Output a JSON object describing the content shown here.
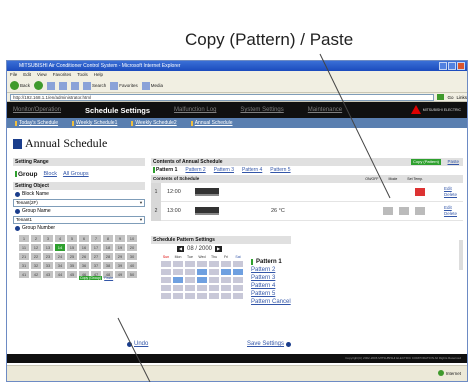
{
  "callout": {
    "top_label": "Copy (Pattern) / Paste"
  },
  "browser": {
    "title": "MITSUBISHI Air Conditioner Control System - Microsoft Internet Explorer",
    "menu": [
      "File",
      "Edit",
      "View",
      "Favorites",
      "Tools",
      "Help"
    ],
    "toolbar": {
      "back": "Back",
      "search": "Search",
      "favorites": "Favorites",
      "media": "Media"
    },
    "address": "http://192.168.1.1/en/administrator.html",
    "go_label": "Go",
    "links_label": "Links",
    "status_zone": "Internet"
  },
  "app": {
    "nav": [
      {
        "label": "Monitor/Operation",
        "active": false
      },
      {
        "label": "Schedule Settings",
        "active": true
      },
      {
        "label": "Malfunction Log",
        "active": false
      },
      {
        "label": "System Settings",
        "active": false
      },
      {
        "label": "Maintenance",
        "active": false
      }
    ],
    "logo_text": "MITSUBISHI ELECTRIC",
    "subnav": [
      "Today's Schedule",
      "Weekly Schedule1",
      "Weekly Schedule2",
      "Annual Schedule"
    ],
    "page_title": "Annual Schedule",
    "setting_range": {
      "header": "Setting Range",
      "group": "Group",
      "block": "Block",
      "all_groups": "All Groups"
    },
    "setting_object": {
      "header": "Setting Object",
      "block_name_label": "Block Name",
      "block_name_value": "Tenant(2F)",
      "group_name_label": "Group Name",
      "group_name_value": "Tenant1",
      "group_number_label": "Group Number",
      "copy_label": "Copy (Group)",
      "paste_label": "Paste",
      "numbers": [
        "1",
        "2",
        "3",
        "4",
        "5",
        "6",
        "7",
        "8",
        "9",
        "10",
        "11",
        "12",
        "13",
        "14",
        "15",
        "16",
        "17",
        "18",
        "19",
        "20",
        "21",
        "22",
        "23",
        "24",
        "25",
        "26",
        "27",
        "28",
        "29",
        "30",
        "31",
        "32",
        "33",
        "34",
        "35",
        "36",
        "37",
        "38",
        "39",
        "40",
        "41",
        "42",
        "43",
        "44",
        "45",
        "46",
        "47",
        "48",
        "49",
        "50"
      ],
      "selected_number": "14"
    },
    "annual_contents": {
      "header": "Contents of Annual Schedule",
      "copy_pattern_label": "Copy (Pattern)",
      "paste_label": "Paste",
      "patterns": [
        "Pattern 1",
        "Pattern 2",
        "Pattern 3",
        "Pattern 4",
        "Pattern 5"
      ],
      "current_pattern": "Pattern 1"
    },
    "schedule_contents": {
      "header": "Contents of Schedule",
      "columns": [
        "ON/OFF",
        "Mode",
        "Set Temp."
      ],
      "rows": [
        {
          "num": "1",
          "time": "12:00",
          "temp": "",
          "edit": "Edit",
          "delete": "Delete"
        },
        {
          "num": "2",
          "time": "13:00",
          "temp": "26 °C",
          "edit": "Edit",
          "delete": "Delete"
        }
      ]
    },
    "pattern_settings": {
      "header": "Schedule Pattern Settings",
      "month": "08 / 2000",
      "days": [
        "Sun",
        "Mon",
        "Tue",
        "Wed",
        "Thu",
        "Fri",
        "Sat"
      ],
      "patterns": [
        "Pattern 1",
        "Pattern 2",
        "Pattern 3",
        "Pattern 4",
        "Pattern 5",
        "Pattern Cancel"
      ],
      "current_pattern": "Pattern 1"
    },
    "undo_label": "Undo",
    "save_label": "Save Settings",
    "footer": "Copyright(C) 2002-2006 MITSUBISHI ELECTRIC CORPORATION All Rights Reserved"
  }
}
